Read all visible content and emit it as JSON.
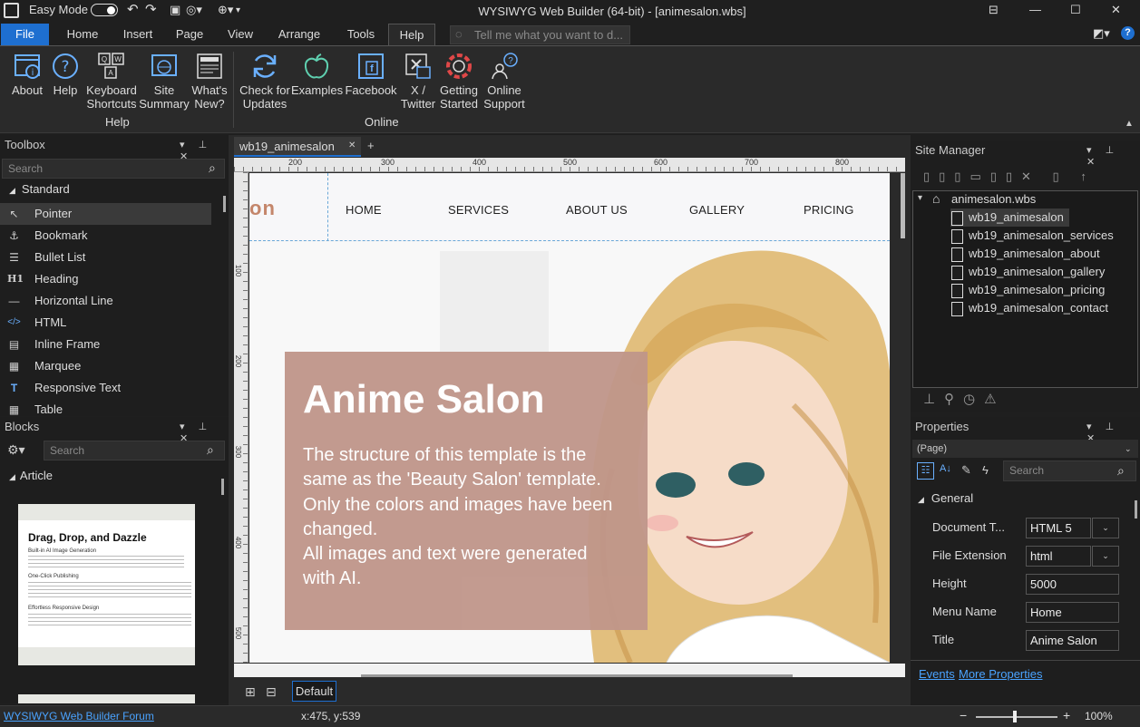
{
  "app": {
    "title": "WYSIWYG Web Builder (64-bit) - [animesalon.wbs]",
    "easy_mode_label": "Easy Mode",
    "tell_me_placeholder": "Tell me what you want to d..."
  },
  "menu": {
    "tabs": [
      "File",
      "Home",
      "Insert",
      "Page",
      "View",
      "Arrange",
      "Tools",
      "Help"
    ],
    "active_tab": "Help"
  },
  "ribbon": {
    "help_group": {
      "label": "Help",
      "buttons": [
        {
          "label1": "About",
          "label2": "",
          "icon": "about-icon"
        },
        {
          "label1": "Help",
          "label2": "",
          "icon": "help-icon"
        },
        {
          "label1": "Keyboard",
          "label2": "Shortcuts",
          "icon": "keyboard-icon"
        },
        {
          "label1": "Site",
          "label2": "Summary",
          "icon": "site-summary-icon"
        },
        {
          "label1": "What's",
          "label2": "New?",
          "icon": "news-icon"
        }
      ]
    },
    "online_group": {
      "label": "Online",
      "buttons": [
        {
          "label1": "Check for",
          "label2": "Updates",
          "icon": "refresh-icon"
        },
        {
          "label1": "Examples",
          "label2": "",
          "icon": "apple-icon"
        },
        {
          "label1": "Facebook",
          "label2": "",
          "icon": "facebook-icon"
        },
        {
          "label1": "X /",
          "label2": "Twitter",
          "icon": "twitter-icon"
        },
        {
          "label1": "Getting",
          "label2": "Started",
          "icon": "lifebuoy-icon"
        },
        {
          "label1": "Online",
          "label2": "Support",
          "icon": "support-icon"
        }
      ]
    }
  },
  "toolbox": {
    "title": "Toolbox",
    "search_placeholder": "Search",
    "section": "Standard",
    "items": [
      "Pointer",
      "Bookmark",
      "Bullet List",
      "Heading",
      "Horizontal Line",
      "HTML",
      "Inline Frame",
      "Marquee",
      "Responsive Text",
      "Table"
    ],
    "selected": "Pointer"
  },
  "blocks": {
    "title": "Blocks",
    "search_placeholder": "Search",
    "section": "Article",
    "preview": {
      "title": "Drag, Drop, and Dazzle",
      "sub1": "Built-in AI Image Generation",
      "sub2": "One-Click Publishing",
      "sub3": "Effortless Responsive Design"
    }
  },
  "editor": {
    "doc_tab": "wb19_animesalon",
    "add_tab": "+",
    "ruler_h": [
      "200",
      "300",
      "400",
      "500",
      "600",
      "700",
      "800"
    ],
    "ruler_v": [
      "100",
      "200",
      "300",
      "400",
      "500"
    ],
    "layout_label": "Default"
  },
  "page_preview": {
    "logo_fragment": "on",
    "nav": [
      "HOME",
      "SERVICES",
      "ABOUT US",
      "GALLERY",
      "PRICING"
    ],
    "hero_title": "Anime Salon",
    "hero_text": [
      "The structure of this template is the",
      "same as the 'Beauty Salon' template.",
      "Only the colors and images have been",
      "changed.",
      "All images and text were generated",
      "with AI."
    ],
    "hero_box_color": "#c0968a"
  },
  "site_manager": {
    "title": "Site Manager",
    "root": "animesalon.wbs",
    "pages": [
      "wb19_animesalon",
      "wb19_animesalon_services",
      "wb19_animesalon_about",
      "wb19_animesalon_gallery",
      "wb19_animesalon_pricing",
      "wb19_animesalon_contact"
    ],
    "selected": "wb19_animesalon"
  },
  "properties": {
    "title": "Properties",
    "object": "(Page)",
    "search_placeholder": "Search",
    "section": "General",
    "rows": [
      {
        "name": "Document T...",
        "value": "HTML 5",
        "dropdown": true
      },
      {
        "name": "File Extension",
        "value": "html",
        "dropdown": true
      },
      {
        "name": "Height",
        "value": "5000",
        "dropdown": false
      },
      {
        "name": "Menu Name",
        "value": "Home",
        "dropdown": false
      },
      {
        "name": "Title",
        "value": "Anime Salon",
        "dropdown": false
      }
    ],
    "events_link": "Events",
    "more_link": "More Properties"
  },
  "status": {
    "forum_link": "WYSIWYG Web Builder Forum",
    "coords": "x:475, y:539",
    "zoom": "100%",
    "zoom_minus": "−",
    "zoom_plus": "+"
  },
  "colors": {
    "accent": "#1e6fd0",
    "link": "#4aa3ff",
    "bg": "#1f1f1f"
  }
}
